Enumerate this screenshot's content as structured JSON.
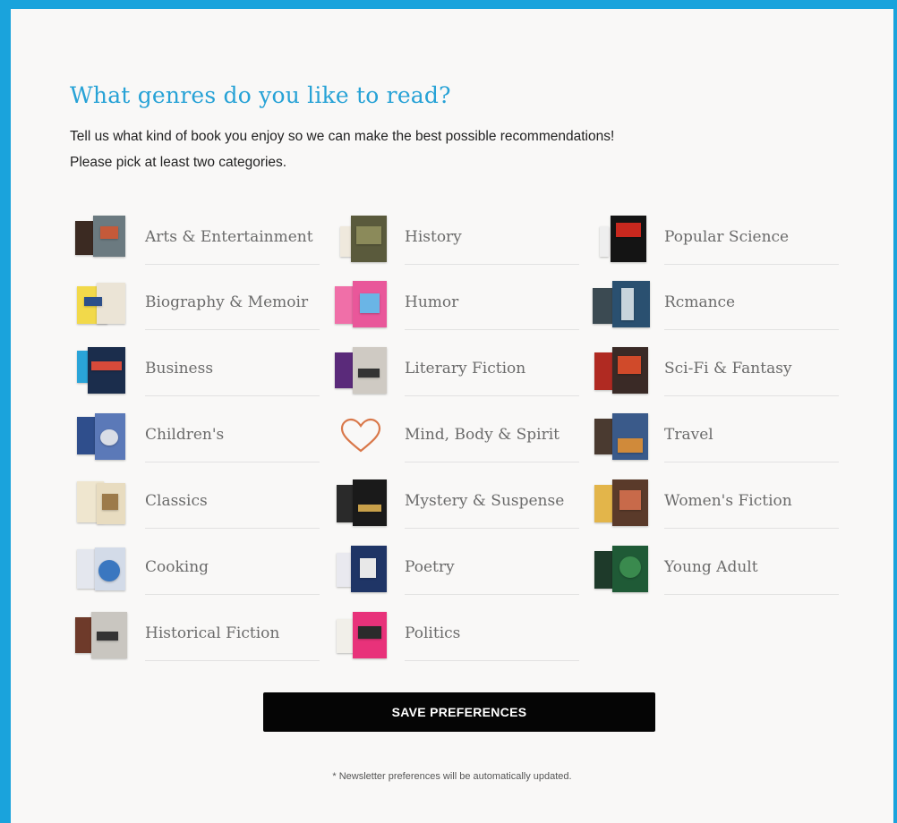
{
  "header": {
    "title": "What genres do you like to read?",
    "subtitle_line1": "Tell us what kind of book you enjoy so we can make the best possible recommendations!",
    "subtitle_line2": "Please pick at least two categories."
  },
  "genres": {
    "arts": {
      "label": "Arts & Entertainment",
      "icon": "book-covers-icon"
    },
    "biography": {
      "label": "Biography & Memoir",
      "icon": "book-covers-icon"
    },
    "business": {
      "label": "Business",
      "icon": "book-covers-icon"
    },
    "childrens": {
      "label": "Children's",
      "icon": "book-covers-icon"
    },
    "classics": {
      "label": "Classics",
      "icon": "book-covers-icon"
    },
    "cooking": {
      "label": "Cooking",
      "icon": "book-covers-icon"
    },
    "historical_fiction": {
      "label": "Historical Fiction",
      "icon": "book-covers-icon"
    },
    "history": {
      "label": "History",
      "icon": "book-covers-icon"
    },
    "humor": {
      "label": "Humor",
      "icon": "book-covers-icon"
    },
    "literary_fiction": {
      "label": "Literary Fiction",
      "icon": "book-covers-icon"
    },
    "mind_body_spirit": {
      "label": "Mind, Body & Spirit",
      "icon": "heart-outline-icon"
    },
    "mystery": {
      "label": "Mystery & Suspense",
      "icon": "book-covers-icon"
    },
    "poetry": {
      "label": "Poetry",
      "icon": "book-covers-icon"
    },
    "politics": {
      "label": "Politics",
      "icon": "book-covers-icon"
    },
    "popular_science": {
      "label": "Popular Science",
      "icon": "book-covers-icon"
    },
    "romance": {
      "label": "Rcmance",
      "icon": "book-covers-icon"
    },
    "scifi_fantasy": {
      "label": "Sci-Fi & Fantasy",
      "icon": "book-covers-icon"
    },
    "travel": {
      "label": "Travel",
      "icon": "book-covers-icon"
    },
    "womens_fiction": {
      "label": "Women's Fiction",
      "icon": "book-covers-icon"
    },
    "young_adult": {
      "label": "Young Adult",
      "icon": "book-covers-icon"
    }
  },
  "actions": {
    "save_label": "SAVE PREFERENCES"
  },
  "footer": {
    "note": "* Newsletter preferences will be automatically updated."
  },
  "colors": {
    "accent": "#1aa3dc",
    "title": "#27a2d6",
    "button": "#050505",
    "heart": "#d9784a"
  }
}
